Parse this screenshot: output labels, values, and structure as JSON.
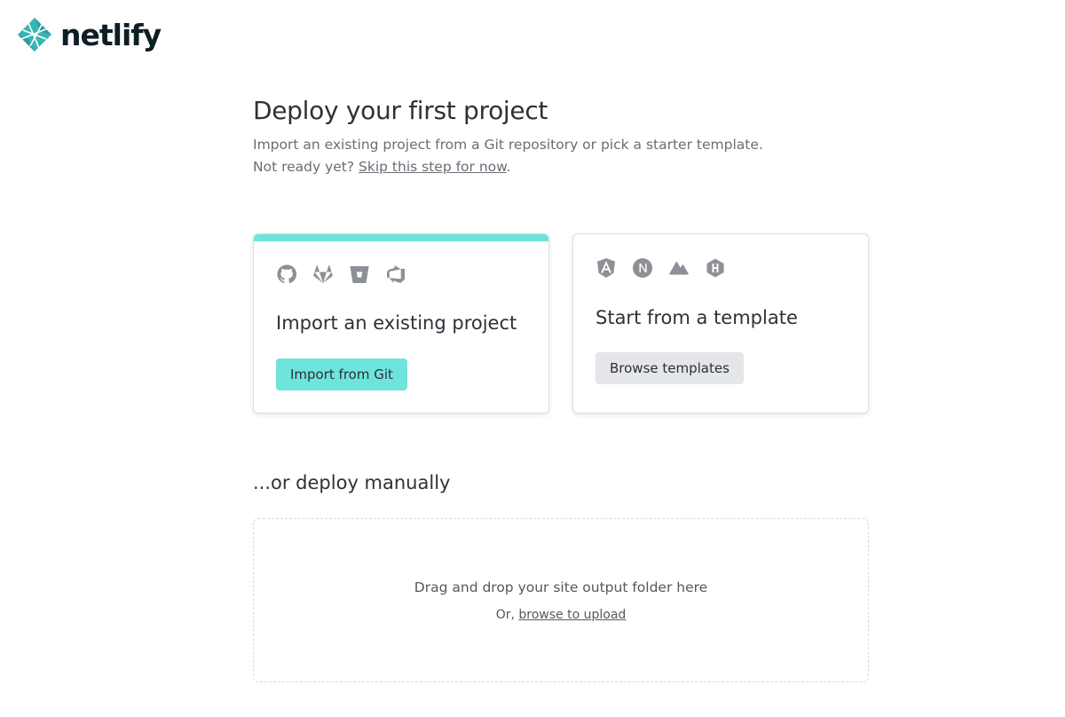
{
  "logo": {
    "text": "netlify"
  },
  "page": {
    "title": "Deploy your first project",
    "subtitle_line1": "Import an existing project from a Git repository or pick a starter template.",
    "not_ready": "Not ready yet?",
    "skip_link": "Skip this step for now",
    "skip_after": "."
  },
  "import_card": {
    "icons": [
      "github-icon",
      "gitlab-icon",
      "bitbucket-icon",
      "azure-devops-icon"
    ],
    "title": "Import an existing project",
    "button_label": "Import from Git",
    "accent_color": "#6ee4dc"
  },
  "template_card": {
    "icons": [
      "angular-icon",
      "nextjs-icon",
      "nuxt-icon",
      "hugo-icon"
    ],
    "title": "Start from a template",
    "button_label": "Browse templates"
  },
  "manual": {
    "title": "...or deploy manually",
    "drop_text": "Drag and drop your site output folder here",
    "or_text": "Or,",
    "browse_link": "browse to upload"
  }
}
